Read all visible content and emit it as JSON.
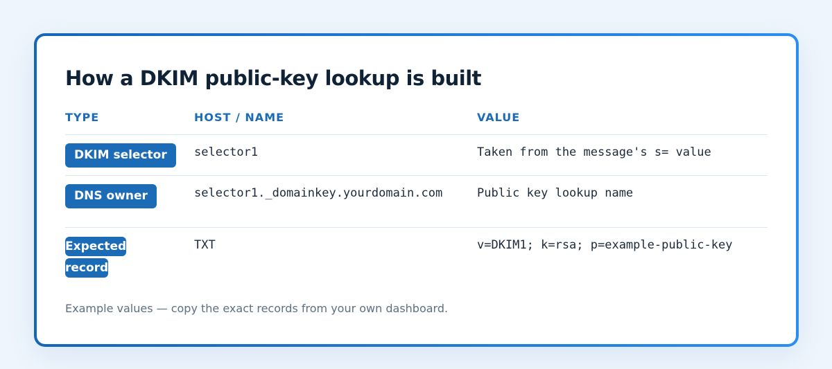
{
  "title": "How a DKIM public-key lookup is built",
  "table": {
    "headers": [
      "TYPE",
      "HOST / NAME",
      "VALUE"
    ],
    "rows": [
      {
        "type": "DKIM selector",
        "host": "selector1",
        "value": "Taken from the message's s= value"
      },
      {
        "type": "DNS owner",
        "host": "selector1._domainkey.yourdomain.com",
        "value": "Public key lookup name"
      },
      {
        "type": "Expected record",
        "host": "TXT",
        "value": "v=DKIM1; k=rsa; p=example-public-key"
      }
    ]
  },
  "note": "Example values — copy the exact records from your own dashboard.",
  "colors": {
    "accent": "#1c6bb7",
    "border_gradient_start": "#1565b8",
    "border_gradient_end": "#2a8ef0",
    "title": "#0f2236",
    "note": "#5d6f82"
  }
}
